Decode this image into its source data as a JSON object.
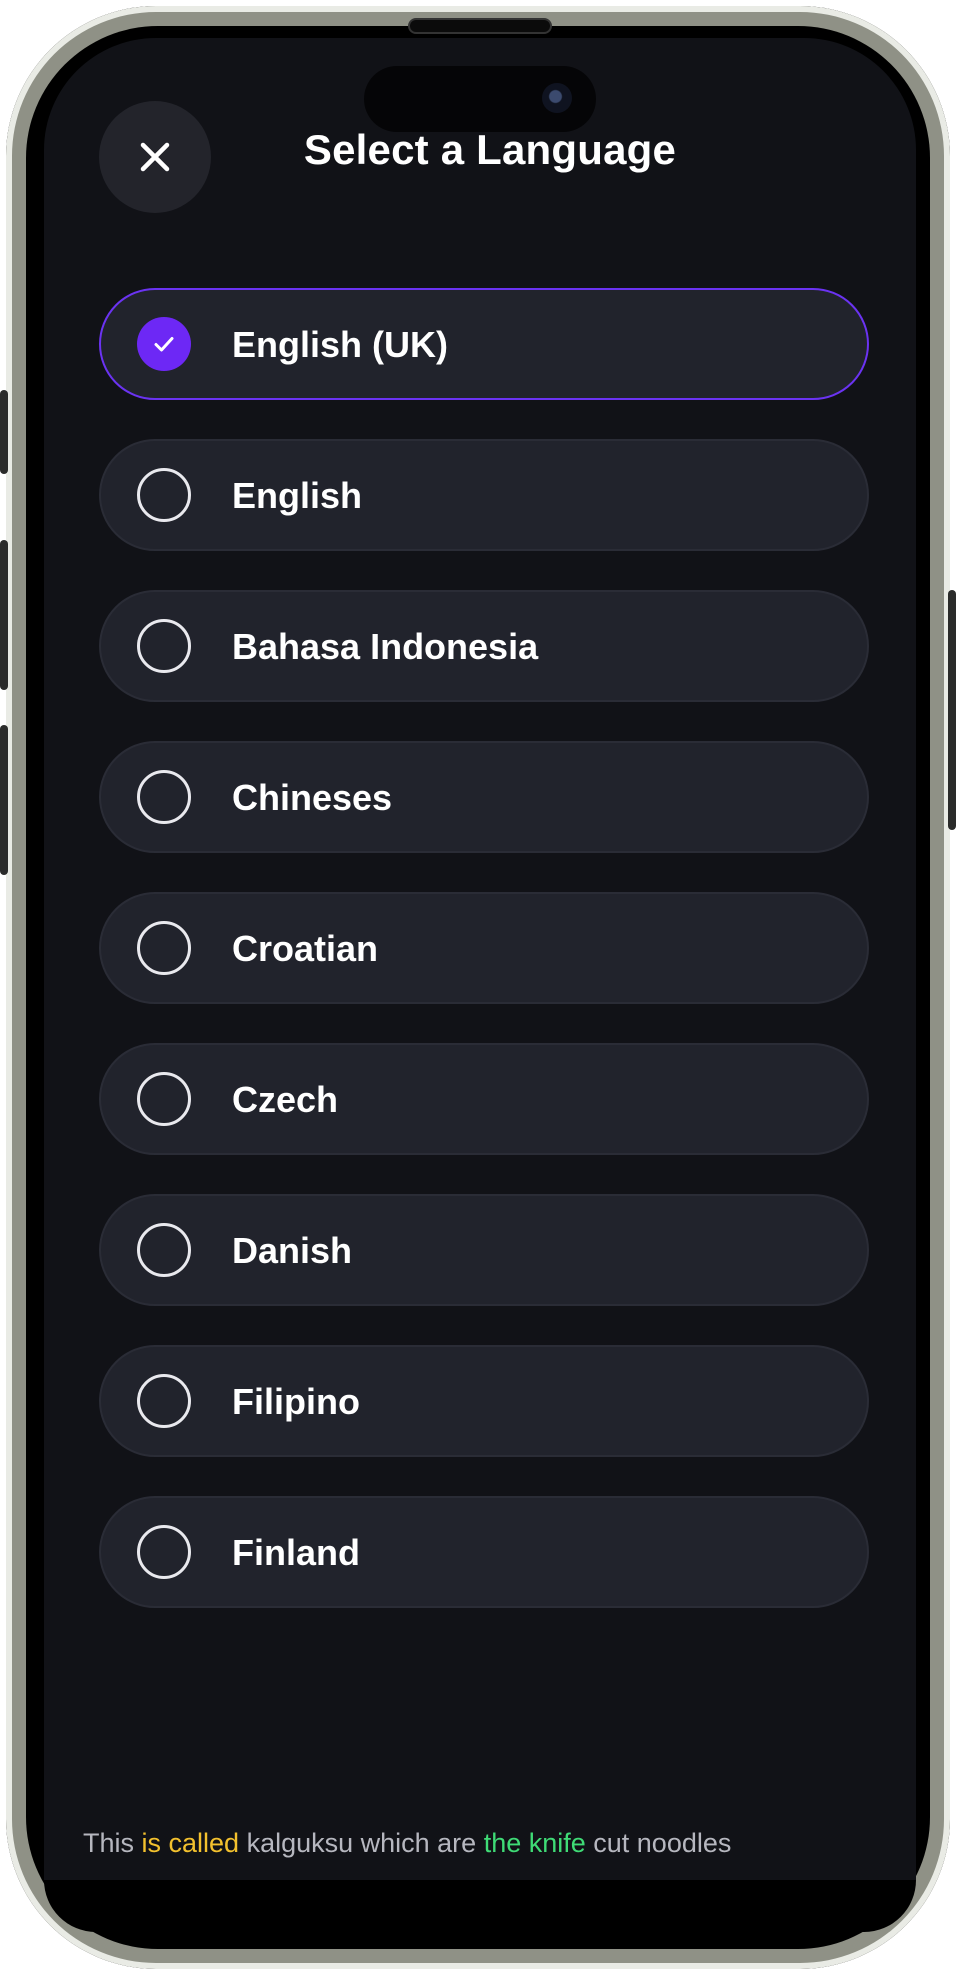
{
  "header": {
    "title": "Select a Language",
    "close_icon": "close-icon"
  },
  "languages": [
    {
      "label": "English (UK)",
      "selected": true
    },
    {
      "label": "English",
      "selected": false
    },
    {
      "label": "Bahasa Indonesia",
      "selected": false
    },
    {
      "label": "Chineses",
      "selected": false
    },
    {
      "label": "Croatian",
      "selected": false
    },
    {
      "label": "Czech",
      "selected": false
    },
    {
      "label": "Danish",
      "selected": false
    },
    {
      "label": "Filipino",
      "selected": false
    },
    {
      "label": "Finland",
      "selected": false
    }
  ],
  "caption": {
    "part1": "This ",
    "part2": "is called",
    "part3": " kalguksu which are ",
    "part4": "the knife",
    "part5": " cut noodles"
  },
  "colors": {
    "accent": "#6d28f5",
    "background": "#111217",
    "item_background": "#21232c",
    "highlight_yellow": "#f3c12e",
    "highlight_green": "#3fdb76"
  }
}
